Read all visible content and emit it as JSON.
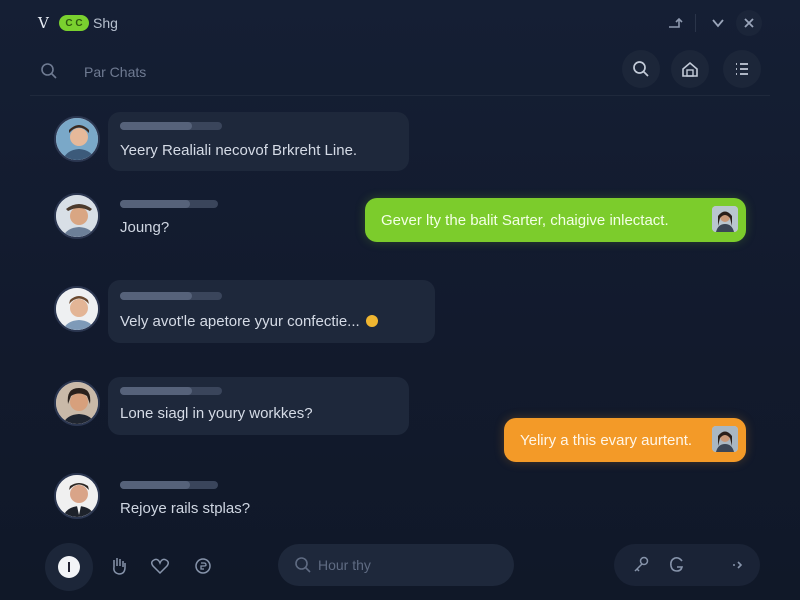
{
  "window": {
    "logo": "V",
    "toggle_glyph": "C C",
    "title": "Shg",
    "minimize_icon": "arrow-icon",
    "chevron_icon": "chevron-down-icon",
    "close_icon": "close-icon"
  },
  "search": {
    "placeholder": "Par Chats",
    "value": ""
  },
  "toolbar_icons": [
    "search-icon",
    "home-icon",
    "list-icon"
  ],
  "messages": [
    {
      "direction": "in",
      "text": "Yeery Realiali necovof Brkreht Line.",
      "has_sender_bar": true
    },
    {
      "direction": "in",
      "text": "Joung?",
      "has_sender_bar": true
    },
    {
      "direction": "out",
      "color": "#7ccc2c",
      "text": "Gever lty the balit Sarter, chaigive inlectact."
    },
    {
      "direction": "in",
      "text": "Vely avot'le apetore yyur confectie...",
      "has_sender_bar": true,
      "emoji": "emoji-icon"
    },
    {
      "direction": "in",
      "text": "Lone siagl in youry workkes?",
      "has_sender_bar": true
    },
    {
      "direction": "out",
      "color": "#f39a28",
      "text": "Yeliry a this evary aurtent."
    },
    {
      "direction": "in",
      "text": "Rejoye rails stplas?",
      "has_sender_bar": true
    }
  ],
  "compose": {
    "placeholder": "Hour thy",
    "value": ""
  },
  "bottom_icons": [
    "mic-icon",
    "hand-icon",
    "heart-icon",
    "coin-icon",
    "link-icon",
    "refresh-icon",
    "send-icon"
  ],
  "colors": {
    "accent_green": "#7ccc2c",
    "accent_orange": "#f39a28",
    "background": "#121a2c",
    "bubble_incoming": "#1e283b"
  }
}
